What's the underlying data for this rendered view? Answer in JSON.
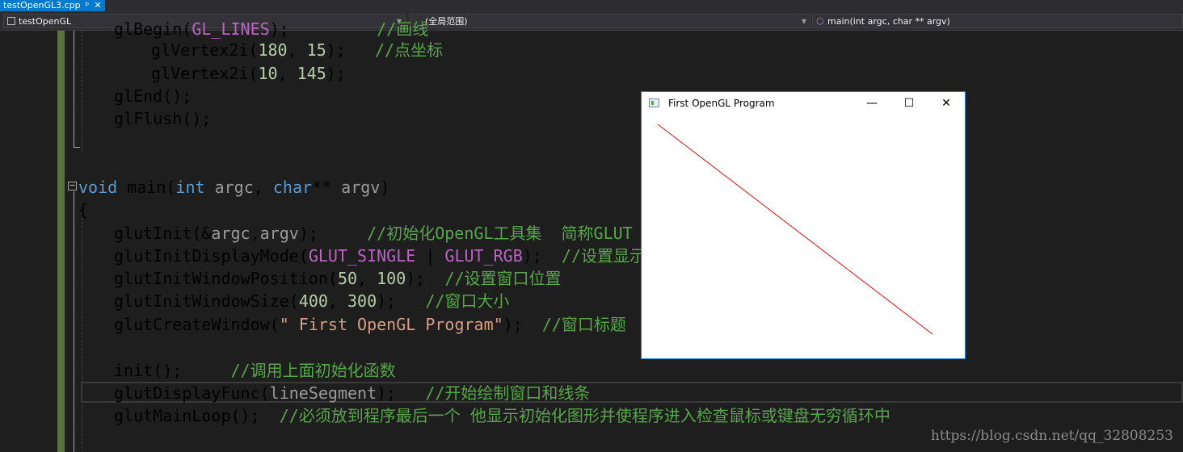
{
  "tab": {
    "filename": "testOpenGL3.cpp",
    "pin": "ᵖ",
    "close": "✕"
  },
  "nav": {
    "project": "testOpenGL",
    "scope": "(全局范围)",
    "function": "main(int argc, char ** argv)"
  },
  "code": {
    "l0a": "glBegin(",
    "l0b": "GL_LINES",
    "l0c": ");",
    "l0cm": "//画线",
    "l1a": "glVertex2i(",
    "l1n1": "180",
    "l1s": ", ",
    "l1n2": "15",
    "l1c": ");",
    "l1cm": "//点坐标",
    "l2a": "glVertex2i(",
    "l2n1": "10",
    "l2s": ", ",
    "l2n2": "145",
    "l2c": ");",
    "l3": "glEnd();",
    "l4": "glFlush();",
    "l6kw": "void",
    "l6fn": " main(",
    "l6t1": "int",
    "l6p1": " argc",
    "l6s": ", ",
    "l6t2": "char",
    "l6st": "**",
    "l6p2": " argv",
    "l6c": ")",
    "l7": "{",
    "l8a": "glutInit(&",
    "l8p1": "argc",
    "l8s": ",",
    "l8p2": "argv",
    "l8c": ");",
    "l8cm": "//初始化OpenGL工具集  简称GLUT",
    "l9a": "glutInitDisplayMode(",
    "l9m1": "GLUT_SINGLE",
    "l9o": " | ",
    "l9m2": "GLUT_RGB",
    "l9c": ");",
    "l9cm": "//设置显示模式",
    "l10a": "glutInitWindowPosition(",
    "l10n1": "50",
    "l10s": ", ",
    "l10n2": "100",
    "l10c": ");",
    "l10cm": "//设置窗口位置",
    "l11a": "glutInitWindowSize(",
    "l11n1": "400",
    "l11s": ", ",
    "l11n2": "300",
    "l11c": ");",
    "l11cm": "//窗口大小",
    "l12a": "glutCreateWindow(",
    "l12str": "\" First OpenGL Program\"",
    "l12c": ");",
    "l12cm": "//窗口标题",
    "l14a": "init();",
    "l14cm": "//调用上面初始化函数",
    "l15a": "glutDisplayFunc(",
    "l15p": "lineSegment",
    "l15c": ");",
    "l15cm": "//开始绘制窗口和线条",
    "l16a": "glutMainLoop();",
    "l16cm": "//必须放到程序最后一个 他显示初始化图形并使程序进入检查鼠标或键盘无穷循环中"
  },
  "glut_window": {
    "title": "First OpenGL Program",
    "minimize": "—",
    "maximize": "☐",
    "close": "✕",
    "line_color": "#d01010"
  },
  "watermark": "https://blog.csdn.net/qq_32808253"
}
